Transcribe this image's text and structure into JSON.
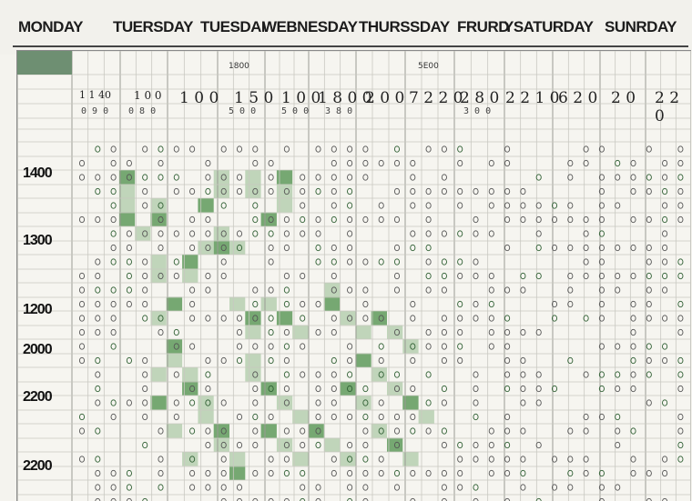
{
  "days": [
    "MONDAY",
    "TUERSDAY",
    "TUESDAI",
    "WEBNESDAY",
    "THURSSDAY",
    "FRURD",
    "YSATURDAY",
    "SUNRDAY"
  ],
  "column_headers": [
    "",
    "",
    "",
    "",
    "1800",
    "",
    "",
    "",
    "5E00",
    "",
    "",
    ""
  ],
  "header_big_values": [
    "1 1 40",
    "1 0 0",
    "1 0 0",
    "1 5 0",
    "1 0 0",
    "1 8 0 0",
    "2 0 0",
    "7 2 2 0",
    "2 8 0",
    "2 2 1 0",
    "6 2 0",
    "2 0",
    "2 2 0"
  ],
  "header_small_values": [
    "0 9 0",
    "0 8 0",
    "",
    "5 0 0",
    "5 0 0",
    "3 8 0",
    "",
    "",
    "3 0 0",
    "",
    "",
    "",
    ""
  ],
  "time_labels": [
    "1400",
    "1300",
    "1200",
    "2000",
    "2200",
    "2200"
  ],
  "colors": {
    "background": "#f4f3ee",
    "grid_line": "#c9c8c1",
    "grid_major": "#9a9a94",
    "highlight_green": "#5f9a5c",
    "highlight_light": "#a9c8a3",
    "corner_green": "#6e8f72"
  }
}
